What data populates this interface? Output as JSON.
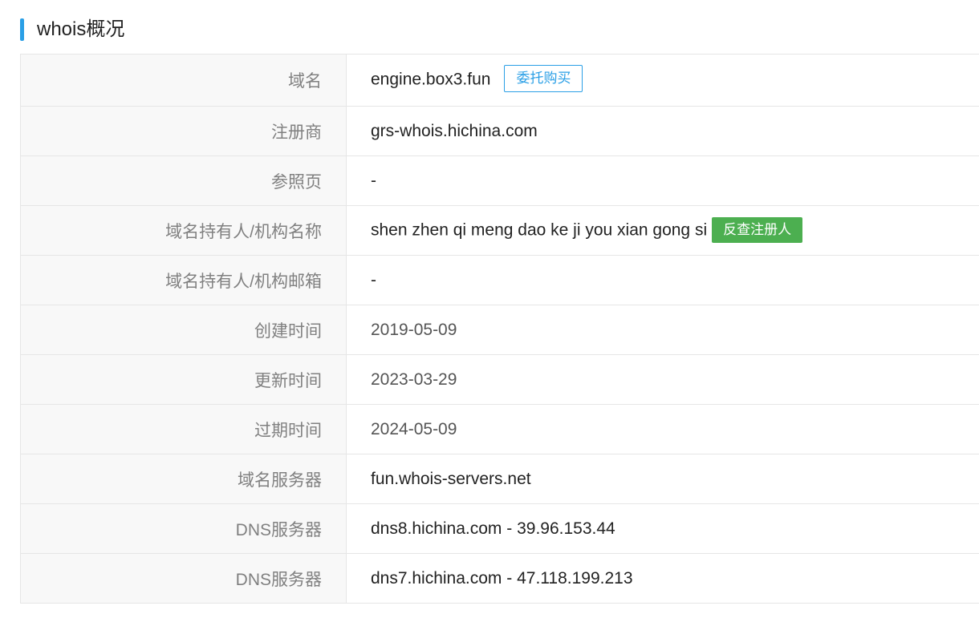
{
  "section": {
    "title": "whois概况"
  },
  "colors": {
    "accent": "#2a9fe6",
    "button_green": "#4caf50",
    "label_bg": "#f8f8f8"
  },
  "rows": [
    {
      "label": "域名",
      "value": "engine.box3.fun",
      "action": "委托购买"
    },
    {
      "label": "注册商",
      "value": "grs-whois.hichina.com"
    },
    {
      "label": "参照页",
      "value": "-"
    },
    {
      "label": "域名持有人/机构名称",
      "value": "shen zhen qi meng dao ke ji you xian gong si",
      "action": "反查注册人"
    },
    {
      "label": "域名持有人/机构邮箱",
      "value": "-"
    },
    {
      "label": "创建时间",
      "value": "2019-05-09"
    },
    {
      "label": "更新时间",
      "value": "2023-03-29"
    },
    {
      "label": "过期时间",
      "value": "2024-05-09"
    },
    {
      "label": "域名服务器",
      "value": "fun.whois-servers.net"
    },
    {
      "label": "DNS服务器",
      "value": "dns8.hichina.com - 39.96.153.44"
    },
    {
      "label": "DNS服务器",
      "value": "dns7.hichina.com - 47.118.199.213"
    }
  ]
}
